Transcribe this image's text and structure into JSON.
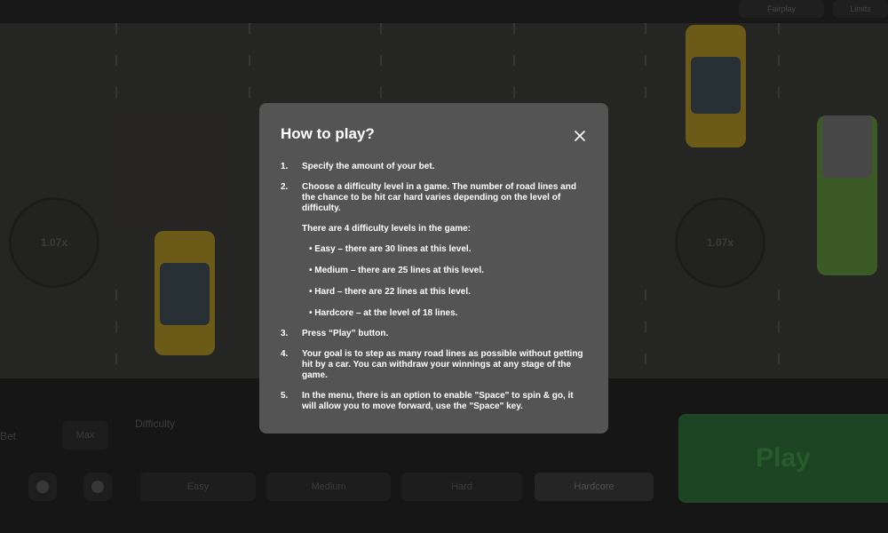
{
  "background": {
    "top_buttons": [
      "Fairplay",
      "Limits"
    ],
    "coins": [
      "1.07x",
      "1.07x"
    ],
    "difficulty_label": "Difficulty",
    "bet_label": "Bet",
    "max_label": "Max",
    "difficulty_options": [
      "Easy",
      "Medium",
      "Hard",
      "Hardcore"
    ],
    "play_label": "Play"
  },
  "modal": {
    "title": "How to play?",
    "steps": [
      {
        "num": "1.",
        "text": "Specify the amount of your bet."
      },
      {
        "num": "2.",
        "text": "Choose a difficulty level in a game. The number of road lines and the chance to be hit car hard varies depending on the level of difficulty."
      },
      {
        "num": "3.",
        "text": "Press  “Play” button."
      },
      {
        "num": "4.",
        "text": "Your goal is to step as many road lines as possible without getting hit by a car. You can withdraw your winnings at any stage of the game."
      },
      {
        "num": "5.",
        "text": "In the menu, there is an option to enable \"Space\" to spin & go, it will allow you to move forward, use the \"Space\" key."
      }
    ],
    "levels_intro": "There are 4 difficulty levels in the game:",
    "levels": [
      "• Easy – there are 30 lines at this level.",
      "• Medium – there are 25 lines at this level.",
      "• Hard – there are 22 lines at this level.",
      "• Hardcore – at the level of 18 lines."
    ]
  }
}
